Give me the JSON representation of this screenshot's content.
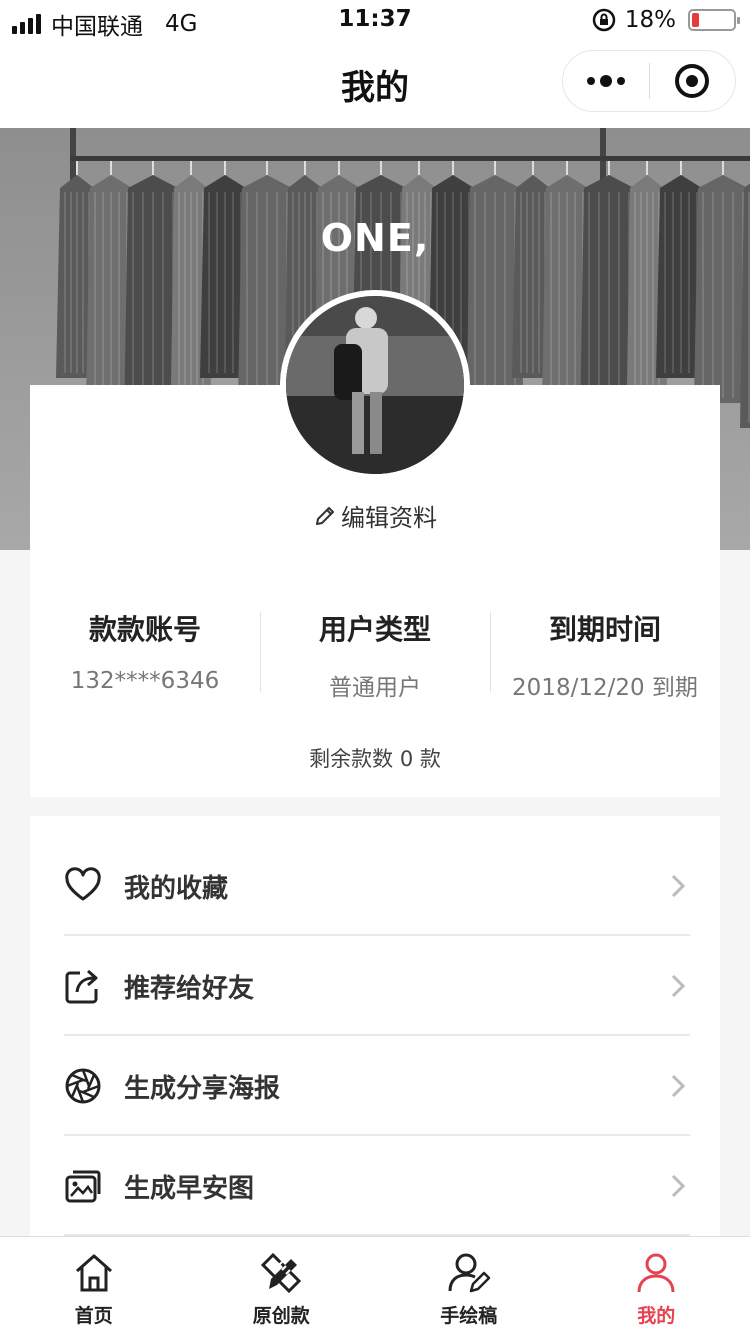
{
  "status_bar": {
    "carrier": "中国联通",
    "network": "4G",
    "time": "11:37",
    "battery_percent": "18%",
    "battery_level": 0.18,
    "battery_color": "#e83a3a"
  },
  "nav": {
    "title": "我的",
    "more_icon": "more-dots-icon",
    "close_icon": "target-icon"
  },
  "hero": {
    "caption": "ONE,"
  },
  "profile": {
    "edit_label": "编辑资料",
    "stats": [
      {
        "label": "款款账号",
        "value": "132****6346"
      },
      {
        "label": "用户类型",
        "value": "普通用户"
      },
      {
        "label": "到期时间",
        "value": "2018/12/20 到期"
      }
    ],
    "remaining": "剩余款数 0 款"
  },
  "menu": [
    {
      "label": "我的收藏",
      "icon": "heart-icon"
    },
    {
      "label": "推荐给好友",
      "icon": "share-icon"
    },
    {
      "label": "生成分享海报",
      "icon": "aperture-icon"
    },
    {
      "label": "生成早安图",
      "icon": "gallery-icon"
    }
  ],
  "tabs": [
    {
      "label": "首页",
      "icon": "home-icon"
    },
    {
      "label": "原创款",
      "icon": "pencil-ruler-icon"
    },
    {
      "label": "手绘稿",
      "icon": "user-edit-icon"
    },
    {
      "label": "我的",
      "icon": "user-icon",
      "active": true
    }
  ],
  "accent_color": "#e8414f"
}
